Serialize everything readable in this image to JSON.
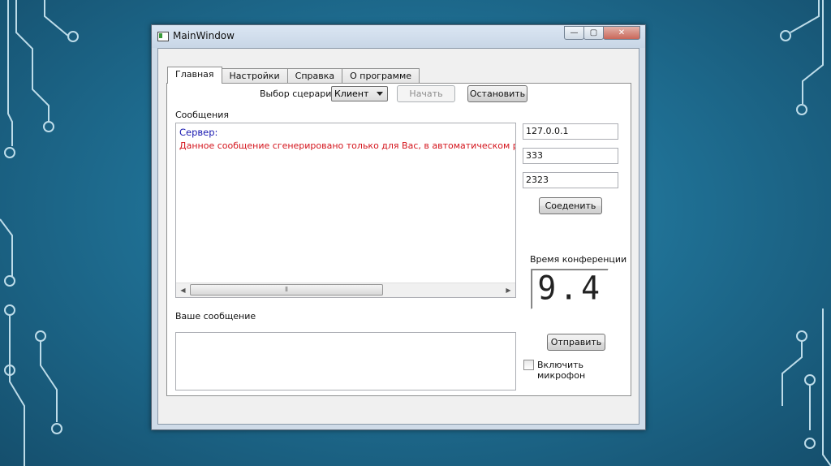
{
  "window": {
    "title": "MainWindow",
    "minimize": "—",
    "maximize": "▢",
    "close": "✕"
  },
  "tabs": [
    {
      "label": "Главная"
    },
    {
      "label": "Настройки"
    },
    {
      "label": "Справка"
    },
    {
      "label": "О программе"
    }
  ],
  "scenario": {
    "label": "Выбор сцерария",
    "selected": "Клиент"
  },
  "buttons": {
    "start": "Начать",
    "stop": "Остановить",
    "connect": "Соеденить",
    "send": "Отправить"
  },
  "messages": {
    "label": "Сообщения",
    "sender": "Сервер:",
    "text": "Данное сообщение сгенерировано только для Вас, в автоматическом режиме"
  },
  "connection": {
    "ip": "127.0.0.1",
    "field2": "333",
    "port": "2323"
  },
  "conference": {
    "label": "Время конференции",
    "time": "9.4"
  },
  "compose": {
    "label": "Ваше сообщение",
    "value": ""
  },
  "microphone": {
    "label": "Включить микрофон",
    "checked": false
  },
  "scrollbar": {
    "left": "◀",
    "right": "▶",
    "grip": "⦀"
  }
}
